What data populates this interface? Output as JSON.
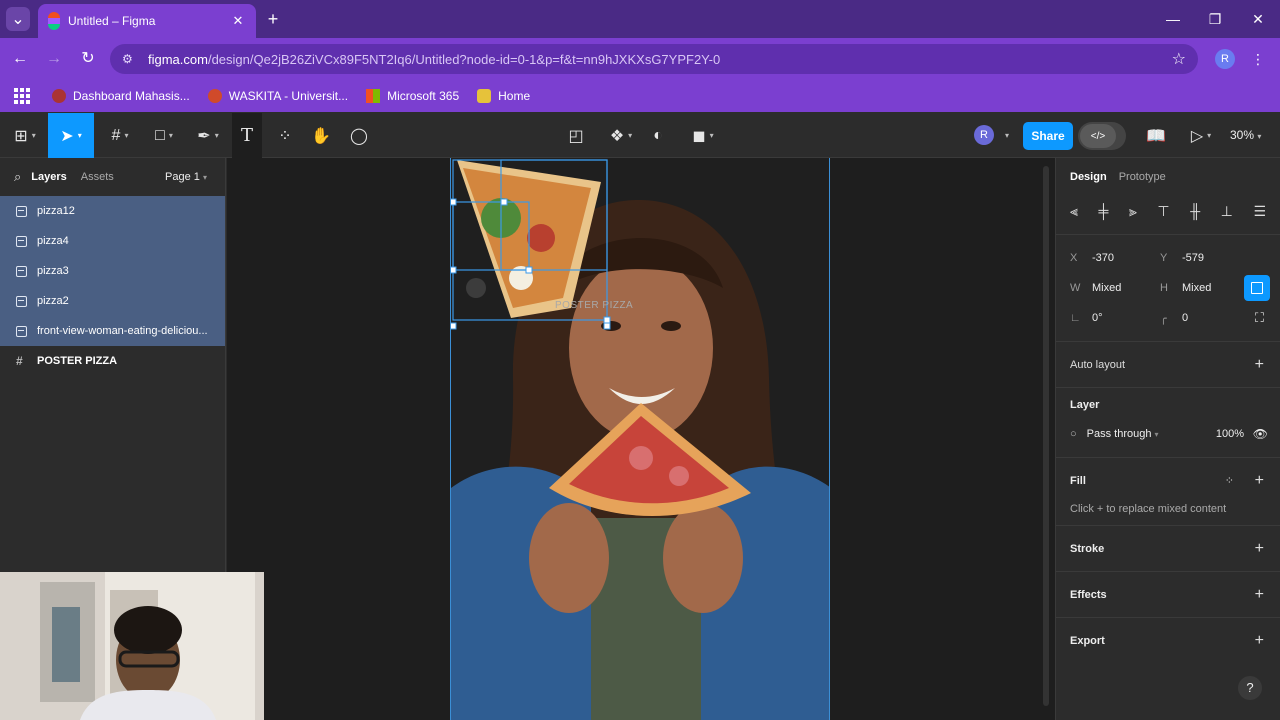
{
  "browser": {
    "tab_title": "Untitled – Figma",
    "url_domain": "figma.com",
    "url_path": "/design/Qe2jB26ZiVCx89F5NT2Iq6/Untitled?node-id=0-1&p=f&t=nn9hJXKXsG7YPF2Y-0",
    "profile_initial": "R",
    "bookmarks": [
      {
        "label": "Dashboard Mahasis...",
        "color": "#a33"
      },
      {
        "label": "WASKITA - Universit...",
        "color": "#d04a2a"
      },
      {
        "label": "Microsoft 365",
        "color": "#f25022"
      },
      {
        "label": "Home",
        "color": "#e6c23a"
      }
    ]
  },
  "toolbar": {
    "share_label": "Share",
    "zoom": "30%",
    "user_initial": "R",
    "devmode_label": "</>"
  },
  "left_panel": {
    "tabs": [
      "Layers",
      "Assets"
    ],
    "page": "Page 1",
    "layers": [
      {
        "name": "pizza12",
        "selected": true
      },
      {
        "name": "pizza4",
        "selected": true
      },
      {
        "name": "pizza3",
        "selected": true
      },
      {
        "name": "pizza2",
        "selected": true
      },
      {
        "name": "front-view-woman-eating-deliciou...",
        "selected": true
      },
      {
        "name": "POSTER PIZZA",
        "selected": false
      }
    ]
  },
  "canvas": {
    "frame_label": "POSTER PIZZA"
  },
  "right_panel": {
    "tabs": [
      "Design",
      "Prototype"
    ],
    "x": "-370",
    "y": "-579",
    "w": "Mixed",
    "h": "Mixed",
    "rotation": "0°",
    "radius": "0",
    "auto_layout": "Auto layout",
    "layer_section": "Layer",
    "blend_mode": "Pass through",
    "opacity": "100%",
    "fill_section": "Fill",
    "fill_hint": "Click + to replace mixed content",
    "stroke_section": "Stroke",
    "effects_section": "Effects",
    "export_section": "Export"
  },
  "colors": {
    "accent": "#0d99ff",
    "browser_purple": "#7b3fd0",
    "selection": "#4a5f83"
  }
}
